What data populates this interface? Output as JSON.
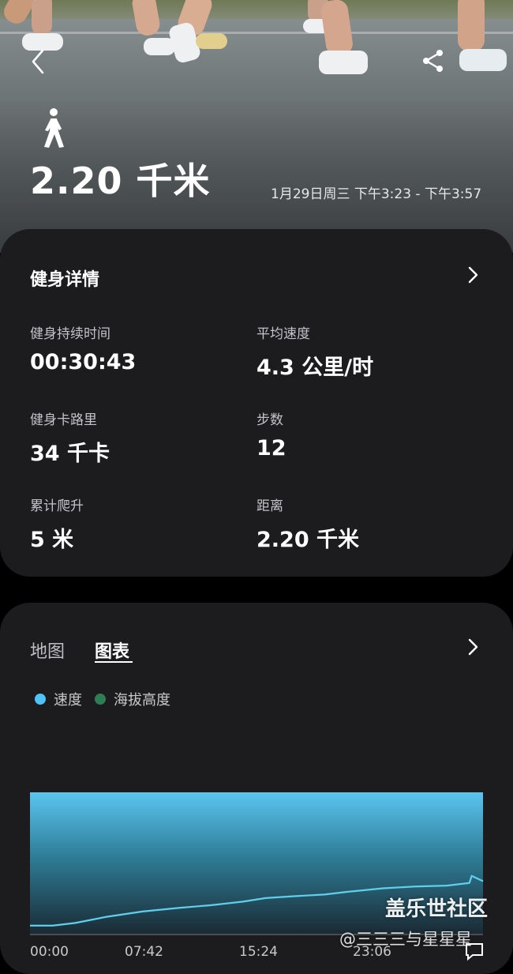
{
  "header": {
    "back_icon": "chevron-left-icon",
    "share_icon": "share-icon",
    "activity_icon": "walking-person-icon",
    "distance": "2.20 千米",
    "date_range": "1月29日周三 下午3:23 - 下午3:57"
  },
  "details": {
    "title": "健身详情",
    "metrics": [
      {
        "label": "健身持续时间",
        "value": "00:30:43"
      },
      {
        "label": "平均速度",
        "value": "4.3 公里/时"
      },
      {
        "label": "健身卡路里",
        "value": "34 千卡"
      },
      {
        "label": "步数",
        "value": "12"
      },
      {
        "label": "累计爬升",
        "value": "5 米"
      },
      {
        "label": "距离",
        "value": "2.20 千米"
      }
    ]
  },
  "chart_section": {
    "tabs": [
      {
        "label": "地图",
        "active": false
      },
      {
        "label": "图表",
        "active": true
      }
    ],
    "legend": [
      {
        "label": "速度",
        "color": "#4fc3f7"
      },
      {
        "label": "海拔高度",
        "color": "#2e7d55"
      }
    ]
  },
  "chart_data": {
    "type": "area",
    "x_tick_labels": [
      "00:00",
      "07:42",
      "15:24",
      "23:06"
    ],
    "series": [
      {
        "name": "速度",
        "color": "#4fc3f7",
        "values": [
          [
            0,
            1.0
          ],
          [
            0.05,
            1.0
          ],
          [
            0.1,
            1.3
          ],
          [
            0.17,
            2.0
          ],
          [
            0.25,
            2.6
          ],
          [
            0.33,
            3.0
          ],
          [
            0.4,
            3.3
          ],
          [
            0.47,
            3.7
          ],
          [
            0.52,
            4.1
          ],
          [
            0.58,
            4.3
          ],
          [
            0.65,
            4.5
          ],
          [
            0.7,
            4.8
          ],
          [
            0.78,
            5.2
          ],
          [
            0.85,
            5.4
          ],
          [
            0.92,
            5.5
          ],
          [
            0.97,
            5.8
          ],
          [
            0.975,
            6.6
          ],
          [
            1.0,
            6.0
          ]
        ]
      },
      {
        "name": "海拔高度",
        "color": "#2e7d55",
        "values": [
          [
            0,
            16
          ],
          [
            1,
            16
          ]
        ]
      }
    ],
    "ylim": [
      0,
      16
    ]
  },
  "watermark": {
    "site": "盖乐世社区",
    "author": "@三三三与星星星"
  }
}
